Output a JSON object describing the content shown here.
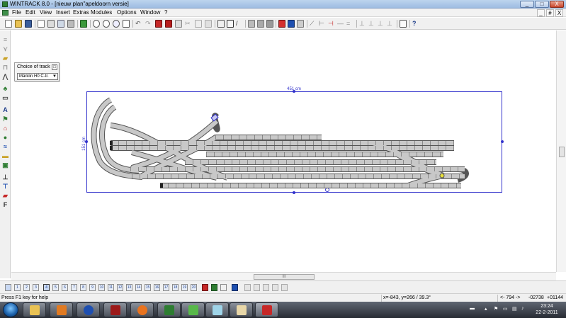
{
  "window": {
    "title": "WINTRACK 8.0 - [nieuw plan\"apeldoorn versie]",
    "controls": [
      "_",
      "□",
      "X"
    ]
  },
  "menu": {
    "items": [
      "File",
      "Edit",
      "View",
      "Insert",
      "Extras",
      "Modules",
      "Options",
      "Window",
      "?"
    ],
    "mdi_controls": [
      "_",
      "#",
      "X"
    ]
  },
  "chooser": {
    "title": "Choice of track",
    "selected": "Märklin H0 C-tr."
  },
  "canvas": {
    "width_label": "451 cm",
    "height_label": "151 cm",
    "frame_color": "#3333cc",
    "track_color": "#c8c8c8"
  },
  "layers": {
    "labels": [
      "1",
      "2",
      "3",
      "4",
      "5",
      "6",
      "7",
      "8",
      "9",
      "10",
      "11",
      "12",
      "13",
      "14",
      "15",
      "16",
      "17",
      "18",
      "19",
      "20"
    ]
  },
  "status": {
    "help": "Press F1 key for help",
    "coords": "x=-843, y=266 / 39.3°",
    "page": "<- 794 ->",
    "coord_x": "-02738",
    "coord_y": "+01144"
  },
  "taskbar": {
    "time": "23:24",
    "date": "22-2-2011"
  }
}
